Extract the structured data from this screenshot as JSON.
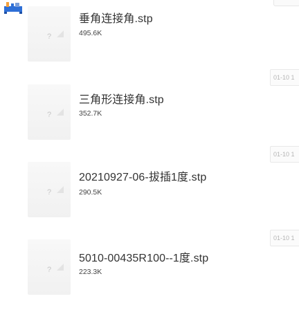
{
  "app": {
    "logo_icon": "app-logo-icon"
  },
  "files": [
    {
      "name": "",
      "name_shown": "垂角连接角.stp",
      "size": "495.6K",
      "icon": "unknown-file-icon",
      "icon_glyph": "?",
      "date": ""
    },
    {
      "name": "",
      "name_shown": "三角形连接角.stp",
      "size": "352.7K",
      "icon": "unknown-file-icon",
      "icon_glyph": "?",
      "date": "01-10 1"
    },
    {
      "name": "",
      "name_shown": "20210927-06-拔插1度.stp",
      "size": "290.5K",
      "icon": "unknown-file-icon",
      "icon_glyph": "?",
      "date": "01-10 1"
    },
    {
      "name": "",
      "name_shown": "5010-00435R100--1度.stp",
      "size": "223.3K",
      "icon": "unknown-file-icon",
      "icon_glyph": "?",
      "date": "01-10 1"
    }
  ],
  "colors": {
    "text_primary": "#333333",
    "text_secondary": "#444444",
    "icon_bg": "#f3f3f3",
    "date_text": "#b5b5b5"
  }
}
